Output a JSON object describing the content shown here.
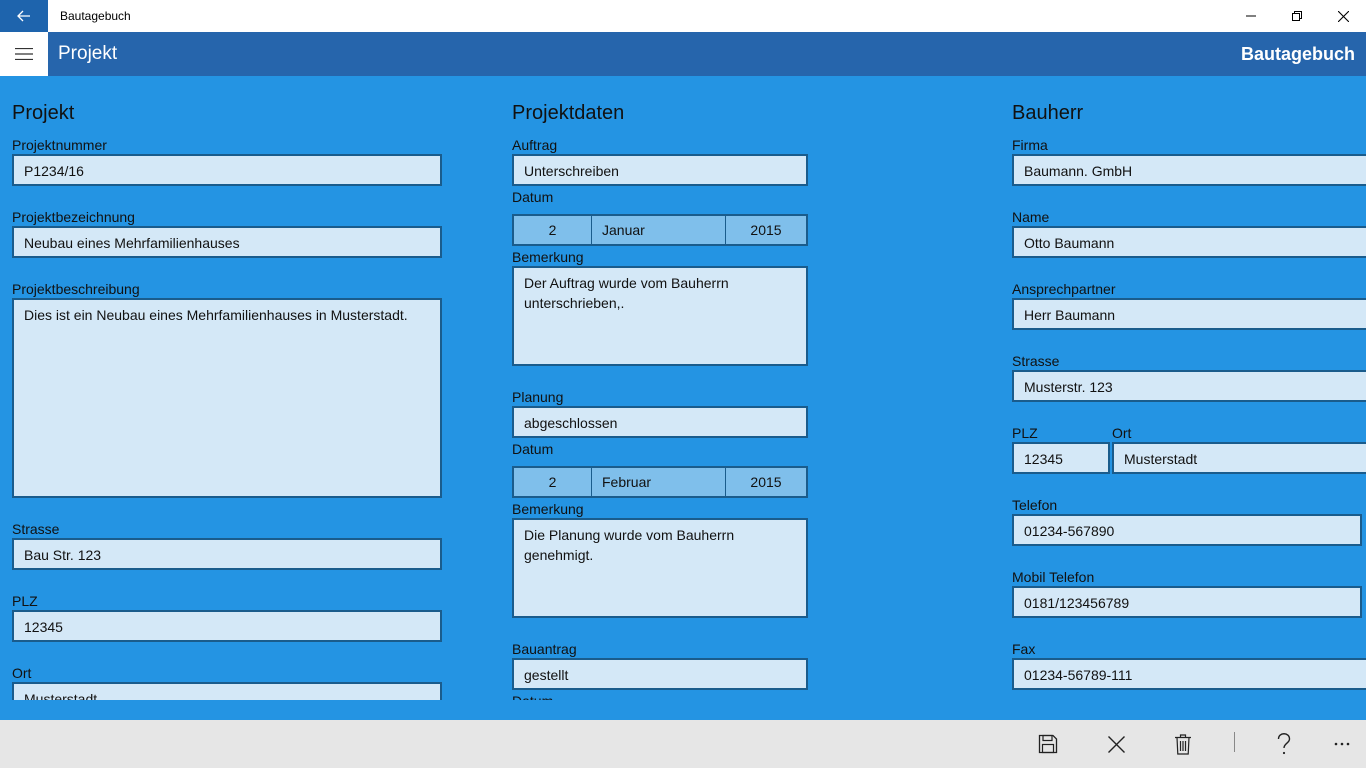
{
  "window": {
    "title": "Bautagebuch"
  },
  "header": {
    "page_title": "Projekt",
    "brand": "Bautagebuch"
  },
  "projekt": {
    "section": "Projekt",
    "nummer_label": "Projektnummer",
    "nummer": "P1234/16",
    "bezeichnung_label": "Projektbezeichnung",
    "bezeichnung": "Neubau eines Mehrfamilienhauses",
    "beschreibung_label": "Projektbeschreibung",
    "beschreibung": "Dies ist ein Neubau eines Mehrfamilienhauses in Musterstadt.",
    "strasse_label": "Strasse",
    "strasse": "Bau Str. 123",
    "plz_label": "PLZ",
    "plz": "12345",
    "ort_label": "Ort",
    "ort": "Musterstadt"
  },
  "projektdaten": {
    "section": "Projektdaten",
    "auftrag_label": "Auftrag",
    "auftrag": "Unterschreiben",
    "auftrag_datum_label": "Datum",
    "auftrag_datum": {
      "day": "2",
      "month": "Januar",
      "year": "2015"
    },
    "auftrag_bemerkung_label": "Bemerkung",
    "auftrag_bemerkung": "Der Auftrag wurde vom Bauherrn unterschrieben,.",
    "planung_label": "Planung",
    "planung": "abgeschlossen",
    "planung_datum_label": "Datum",
    "planung_datum": {
      "day": "2",
      "month": "Februar",
      "year": "2015"
    },
    "planung_bemerkung_label": "Bemerkung",
    "planung_bemerkung": "Die Planung wurde vom Bauherrn genehmigt.",
    "bauantrag_label": "Bauantrag",
    "bauantrag": "gestellt",
    "bauantrag_datum_label": "Datum"
  },
  "bauherr": {
    "section": "Bauherr",
    "firma_label": "Firma",
    "firma": "Baumann. GmbH",
    "name_label": "Name",
    "name": "Otto Baumann",
    "ansprech_label": "Ansprechpartner",
    "ansprech": "Herr Baumann",
    "strasse_label": "Strasse",
    "strasse": "Musterstr. 123",
    "plz_label": "PLZ",
    "plz": "12345",
    "ort_label": "Ort",
    "ort": "Musterstadt",
    "telefon_label": "Telefon",
    "telefon": "01234-567890",
    "mobil_label": "Mobil Telefon",
    "mobil": "0181/123456789",
    "fax_label": "Fax",
    "fax": "01234-56789-111"
  },
  "commands": [
    "save-icon",
    "close-icon",
    "trash-icon",
    "help-icon",
    "more-icon"
  ],
  "colors": {
    "background": "#2494e3",
    "header": "#2665ac",
    "field": "#d4e8f7",
    "date": "#7fbfeb",
    "border": "#1a5c8c"
  }
}
